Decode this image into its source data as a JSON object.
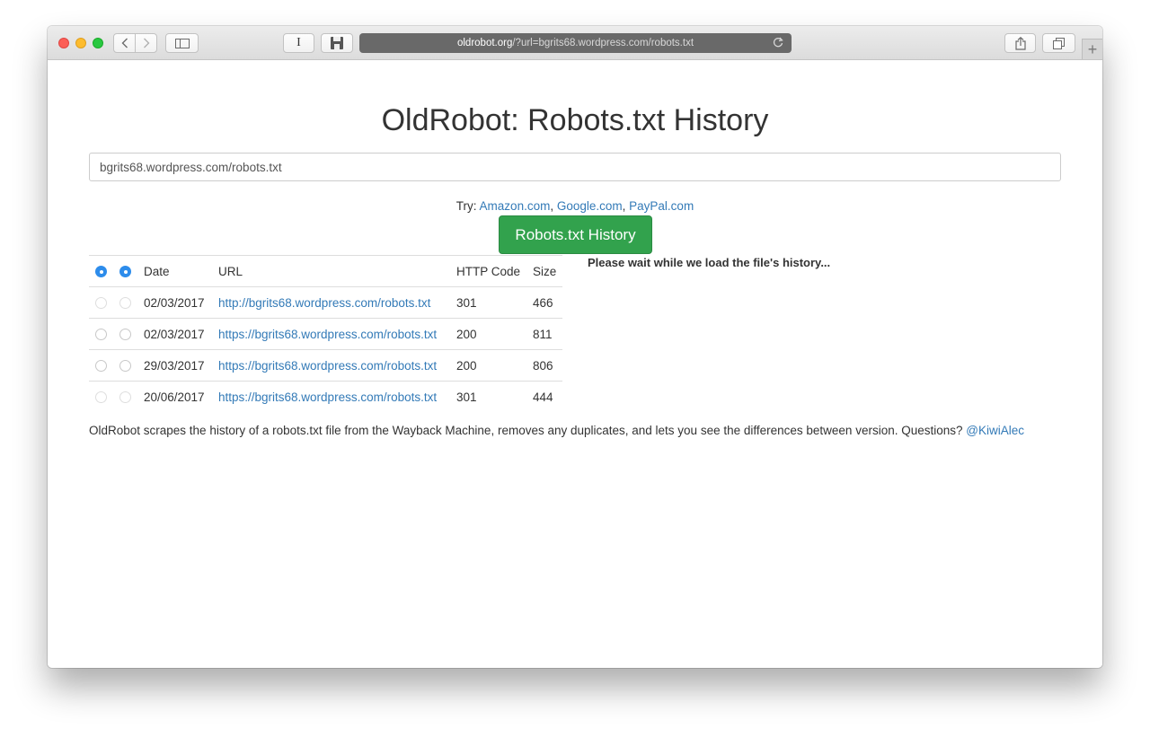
{
  "browser": {
    "url_domain": "oldrobot.org",
    "url_rest": "/?url=bgrits68.wordpress.com/robots.txt",
    "reader_label": "I"
  },
  "page": {
    "title": "OldRobot: Robots.txt History",
    "search_value": "bgrits68.wordpress.com/robots.txt",
    "try_prefix": "Try: ",
    "try_links": [
      "Amazon.com",
      "Google.com",
      "PayPal.com"
    ],
    "button_label": "Robots.txt History",
    "wait_message": "Please wait while we load the file's history...",
    "footer_text": "OldRobot scrapes the history of a robots.txt file from the Wayback Machine, removes any duplicates, and lets you see the differences between version. Questions? ",
    "footer_link": "@KiwiAlec"
  },
  "table": {
    "headers": {
      "date": "Date",
      "url": "URL",
      "code": "HTTP Code",
      "size": "Size"
    },
    "rows": [
      {
        "date": "02/03/2017",
        "url": "http://bgrits68.wordpress.com/robots.txt",
        "code": "301",
        "size": "466"
      },
      {
        "date": "02/03/2017",
        "url": "https://bgrits68.wordpress.com/robots.txt",
        "code": "200",
        "size": "811"
      },
      {
        "date": "29/03/2017",
        "url": "https://bgrits68.wordpress.com/robots.txt",
        "code": "200",
        "size": "806"
      },
      {
        "date": "20/06/2017",
        "url": "https://bgrits68.wordpress.com/robots.txt",
        "code": "301",
        "size": "444"
      }
    ]
  },
  "colors": {
    "link": "#337ab7",
    "button_green": "#32a24d",
    "radio_selected": "#2d8ceb"
  }
}
